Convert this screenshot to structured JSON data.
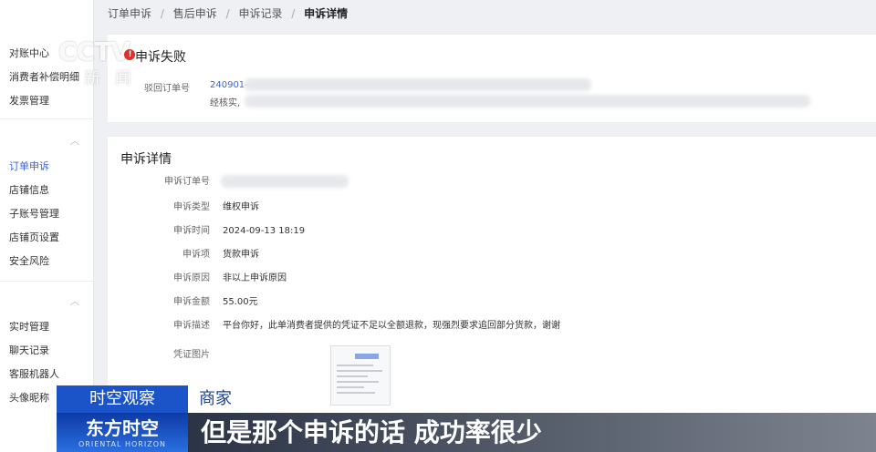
{
  "breadcrumb": {
    "items": [
      "订单申诉",
      "售后申诉",
      "申诉记录"
    ],
    "current": "申诉详情",
    "separator": "/"
  },
  "sidebar": {
    "group1": [
      "对账中心",
      "消费者补偿明细",
      "发票管理"
    ],
    "group2": [
      "订单申诉",
      "店铺信息",
      "子账号管理",
      "店铺页设置",
      "安全风险"
    ],
    "group3": [
      "实时管理",
      "聊天记录",
      "客服机器人",
      "头像昵称"
    ],
    "active": "订单申诉"
  },
  "result": {
    "title": "申诉失败",
    "reject_label": "驳回订单号",
    "reject_value": "240901-",
    "note": "经核实,"
  },
  "detail": {
    "title": "申诉详情",
    "rows": [
      {
        "label": "申诉订单号",
        "value": ""
      },
      {
        "label": "申诉类型",
        "value": "维权申诉"
      },
      {
        "label": "申诉时间",
        "value": "2024-09-13 18:19"
      },
      {
        "label": "申诉项",
        "value": "货款申诉"
      },
      {
        "label": "申诉原因",
        "value": "非以上申诉原因"
      },
      {
        "label": "申诉金额",
        "value": "55.00元"
      },
      {
        "label": "申诉描述",
        "value": "平台你好，此单消费者提供的凭证不足以全额退款，现强烈要求追回部分货款，谢谢"
      },
      {
        "label": "凭证图片",
        "value": ""
      }
    ]
  },
  "watermark": {
    "logo": "CCTV",
    "sub": "新闻"
  },
  "overlay": {
    "show": "时空观察",
    "speaker": "商家",
    "brand": "东方时空",
    "brand_en": "ORIENTAL HORIZON",
    "subtitle": "但是那个申诉的话 成功率很少"
  },
  "colors": {
    "accent": "#3b63d6",
    "overlay_blue": "#1b54c8"
  }
}
